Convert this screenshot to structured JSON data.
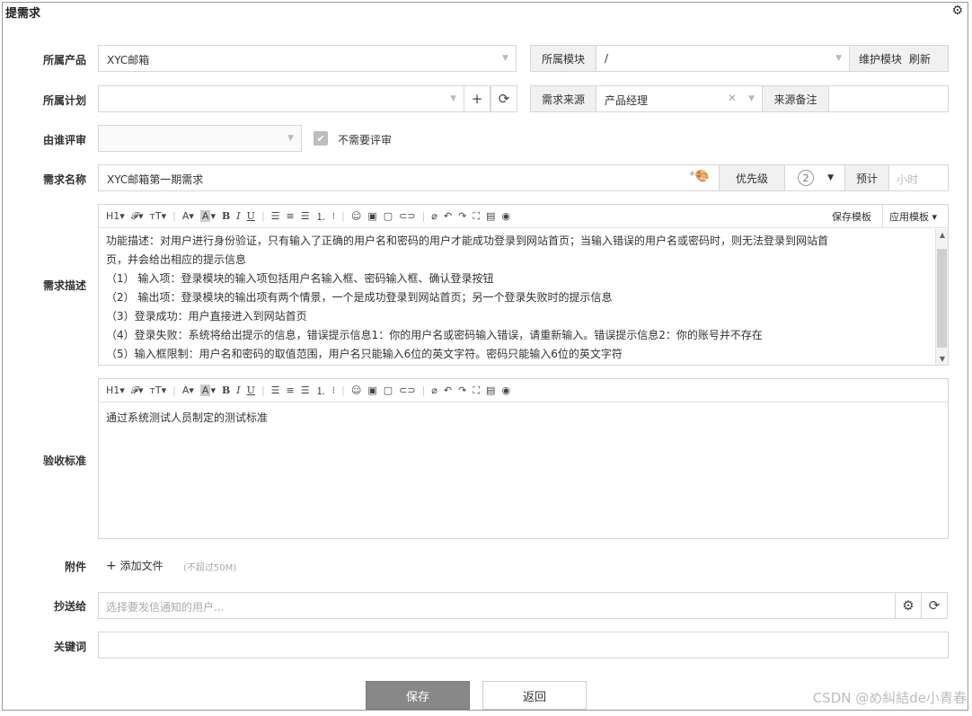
{
  "page": {
    "title": "提需求"
  },
  "fields": {
    "product": {
      "label": "所属产品",
      "value": "XYC邮箱"
    },
    "module": {
      "label": "所属模块",
      "value": "/",
      "maintain": "维护模块",
      "refresh": "刷新"
    },
    "plan": {
      "label": "所属计划",
      "value": ""
    },
    "source": {
      "label": "需求来源",
      "value": "产品经理",
      "note_label": "来源备注"
    },
    "reviewer": {
      "label": "由谁评审",
      "no_review": "不需要评审"
    },
    "name": {
      "label": "需求名称",
      "value": "XYC邮箱第一期需求",
      "priority": "优先级",
      "priority_value": "2",
      "estimate": "预计",
      "estimate_unit": "小时"
    },
    "description": {
      "label": "需求描述",
      "save_template": "保存模板",
      "apply_template": "应用模板",
      "lines": [
        "功能描述：对用户进行身份验证，只有输入了正确的用户名和密码的用户才能成功登录到网站首页；当输入错误的用户名或密码时，则无法登录到网站首",
        "页，并会给出相应的提示信息",
        "（1） 输入项：登录模块的输入项包括用户名输入框、密码输入框、确认登录按钮",
        "（2） 输出项：登录模块的输出项有两个情景，一个是成功登录到网站首页；另一个登录失败时的提示信息",
        "（3）登录成功：用户直接进入到网站首页",
        "（4）登录失败：系统将给出提示的信息，错误提示信息1：你的用户名或密码输入错误，请重新输入。错误提示信息2：你的账号并不存在",
        "（5）输入框限制：用户名和密码的取值范围，用户名只能输入6位的英文字符。密码只能输入6位的英文字符"
      ]
    },
    "acceptance": {
      "label": "验收标准",
      "text": "通过系统测试人员制定的测试标准"
    },
    "attachment": {
      "label": "附件",
      "add": "添加文件",
      "limit": "(不超过50M)"
    },
    "cc": {
      "label": "抄送给",
      "placeholder": "选择要发信通知的用户..."
    },
    "keywords": {
      "label": "关键词",
      "value": ""
    }
  },
  "toolbar": {
    "h1": "H1",
    "font": "𝓕",
    "size": "ᴛT",
    "color": "A",
    "bg": "A",
    "bold": "B",
    "italic": "I",
    "underline": "U"
  },
  "actions": {
    "save": "保存",
    "back": "返回"
  },
  "watermark": "CSDN @め糾結de小青春"
}
